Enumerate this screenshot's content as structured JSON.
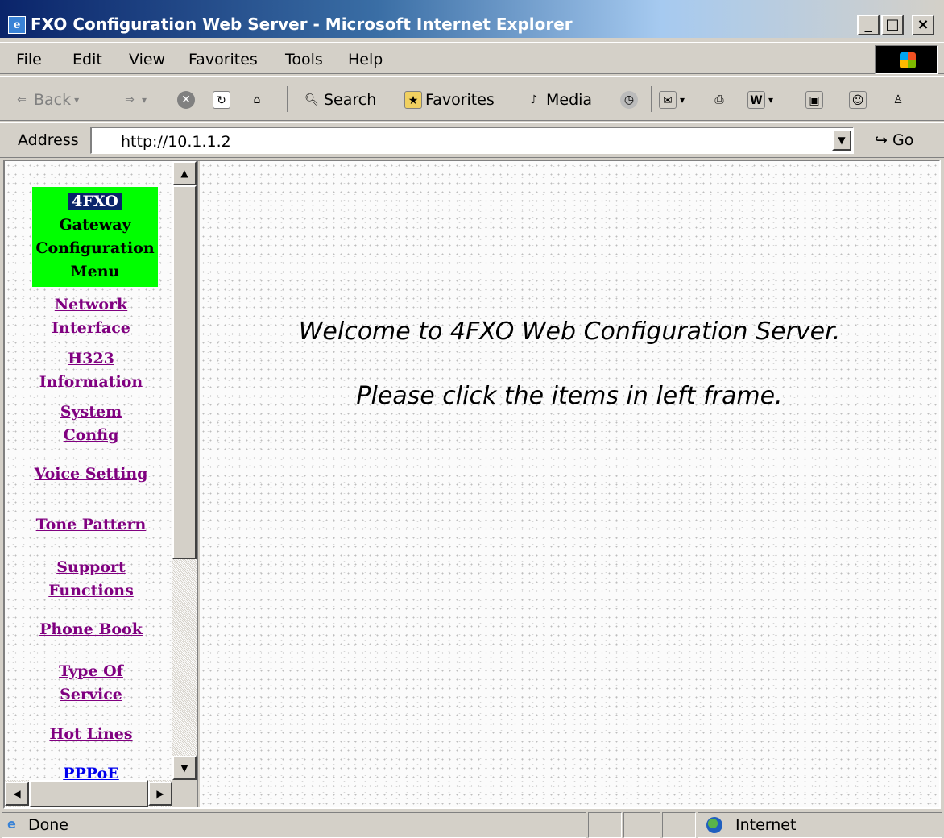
{
  "window": {
    "title": "FXO Configuration Web Server - Microsoft Internet Explorer",
    "minimize": "_",
    "maximize": "□",
    "close": "×"
  },
  "menubar": [
    "File",
    "Edit",
    "View",
    "Favorites",
    "Tools",
    "Help"
  ],
  "toolbar": {
    "back": "Back",
    "search": "Search",
    "favorites": "Favorites",
    "media": "Media",
    "go": "Go"
  },
  "address": {
    "label": "Address",
    "value": "http://10.1.1.2"
  },
  "left_menu": {
    "header_highlight": "4FXO",
    "header_lines": [
      "Gateway",
      "Configuration",
      "Menu"
    ],
    "items": [
      {
        "label_lines": [
          "Network",
          "Interface"
        ]
      },
      {
        "label_lines": [
          "H323",
          "Information"
        ]
      },
      {
        "label_lines": [
          "System",
          "Config"
        ]
      },
      {
        "label_lines": [
          "Voice Setting"
        ]
      },
      {
        "label_lines": [
          "Tone Pattern"
        ]
      },
      {
        "label_lines": [
          "Support",
          "Functions"
        ]
      },
      {
        "label_lines": [
          "Phone Book"
        ]
      },
      {
        "label_lines": [
          "Type Of",
          "Service"
        ]
      },
      {
        "label_lines": [
          "Hot Lines"
        ]
      },
      {
        "label_lines": [
          "PPPoE"
        ]
      }
    ]
  },
  "main": {
    "welcome": "Welcome to 4FXO Web Configuration Server.",
    "instruction": "Please click the items in left frame."
  },
  "status": {
    "text": "Done",
    "zone": "Internet"
  }
}
